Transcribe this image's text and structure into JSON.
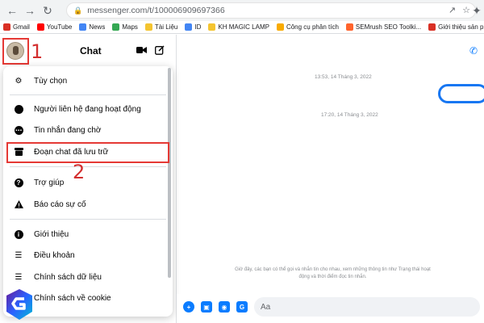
{
  "browser": {
    "url": "messenger.com/t/100006909697366",
    "bookmarks": [
      {
        "label": "Gmail",
        "icon": "gmail-icon",
        "color": "#d93025"
      },
      {
        "label": "YouTube",
        "icon": "youtube-icon",
        "color": "#ff0000"
      },
      {
        "label": "News",
        "icon": "google-news-icon",
        "color": "#4285f4"
      },
      {
        "label": "Maps",
        "icon": "maps-icon",
        "color": "#34a853"
      },
      {
        "label": "Tài Liệu",
        "icon": "folder-icon",
        "color": "#f4c430"
      },
      {
        "label": "ID",
        "icon": "google-icon",
        "color": "#4285f4"
      },
      {
        "label": "KH MAGIC LAMP",
        "icon": "folder-icon",
        "color": "#f4c430"
      },
      {
        "label": "Công cụ phân tích",
        "icon": "analytics-icon",
        "color": "#f9ab00"
      },
      {
        "label": "SEMrush SEO Toolki...",
        "icon": "semrush-icon",
        "color": "#ff642d"
      },
      {
        "label": "Giới thiệu sản phẩ...",
        "icon": "product-icon",
        "color": "#d93025"
      }
    ]
  },
  "header": {
    "title": "Chat",
    "video_icon": "video-call-icon",
    "compose_icon": "new-message-icon"
  },
  "annotations": {
    "step1": "1",
    "step2": "2",
    "accent": "#e53935"
  },
  "menu": {
    "items": [
      {
        "label": "Tùy chọn",
        "icon": "gear-icon"
      },
      {
        "label": "Người liên hệ đang hoạt động",
        "icon": "active-contacts-icon"
      },
      {
        "label": "Tin nhắn đang chờ",
        "icon": "message-request-icon"
      },
      {
        "label": "Đoạn chat đã lưu trữ",
        "icon": "archive-icon"
      },
      {
        "label": "Trợ giúp",
        "icon": "help-icon"
      },
      {
        "label": "Báo cáo sự cố",
        "icon": "warning-icon"
      },
      {
        "label": "Giới thiệu",
        "icon": "info-icon"
      },
      {
        "label": "Điều khoản",
        "icon": "document-lines-icon"
      },
      {
        "label": "Chính sách dữ liệu",
        "icon": "document-lines-icon"
      },
      {
        "label": "Chính sách về cookie",
        "icon": "document-lines-icon"
      }
    ]
  },
  "conversation": {
    "timestamp1": "13:53, 14 Tháng 3, 2022",
    "timestamp2": "17:20, 14 Tháng 3, 2022",
    "info_text": "Giờ đây, các bạn có thể gọi và nhắn tin cho nhau, xem những thông tin như Trạng thái hoạt động và thời điểm đọc tin nhắn.",
    "composer_placeholder": "Aa",
    "accent_color": "#0a7cff"
  }
}
